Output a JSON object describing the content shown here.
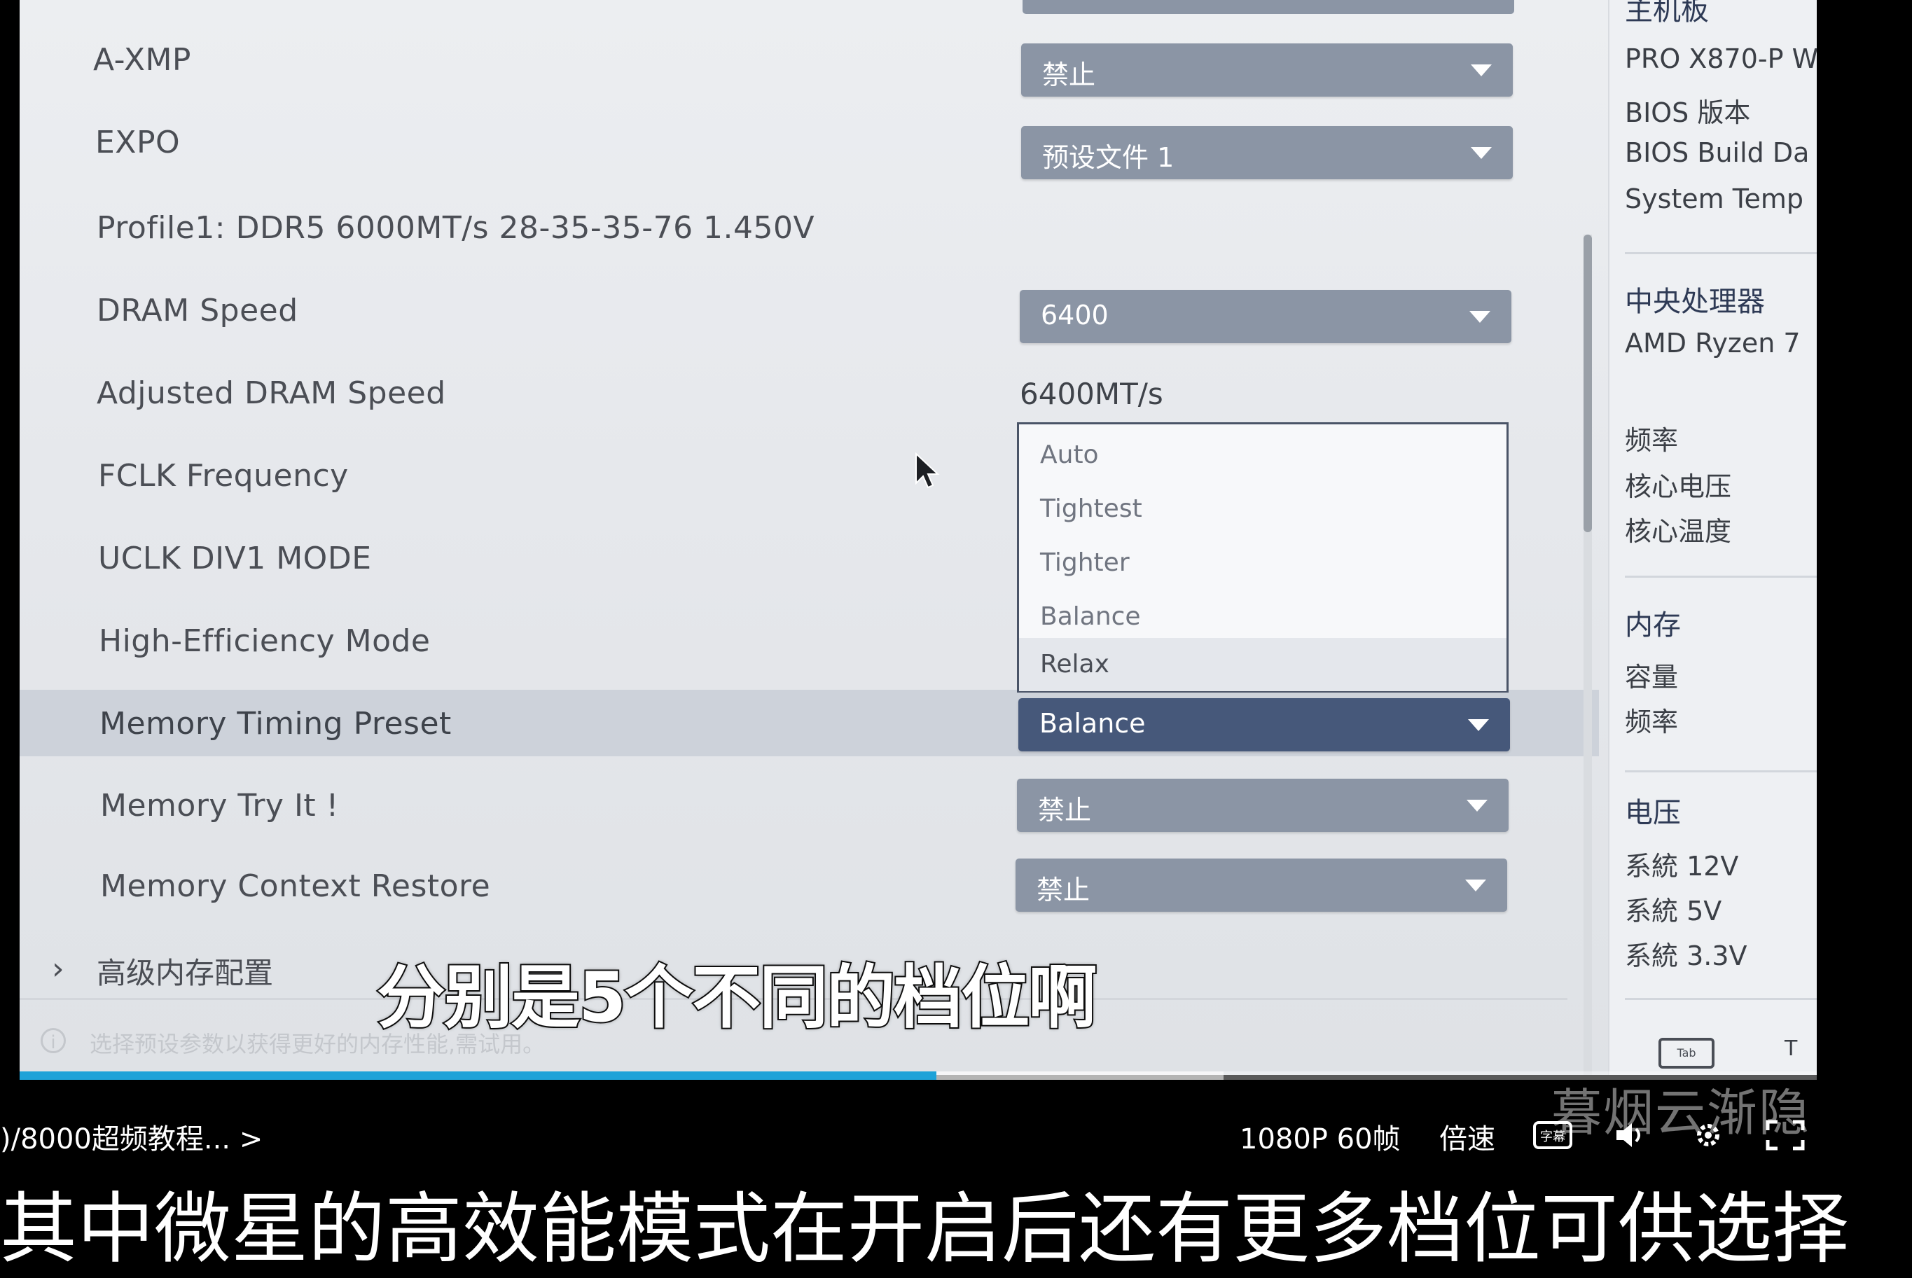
{
  "bios": {
    "settings": [
      {
        "label": "A-XMP",
        "value": "禁止"
      },
      {
        "label": "EXPO",
        "value": "预设文件 1"
      },
      {
        "label": "Profile1: DDR5 6000MT/s 28-35-35-76 1.450V"
      },
      {
        "label": "DRAM Speed",
        "value": "6400"
      },
      {
        "label": "Adjusted DRAM Speed",
        "value": "6400MT/s"
      },
      {
        "label": "FCLK Frequency"
      },
      {
        "label": "UCLK DIV1 MODE"
      },
      {
        "label": "High-Efficiency Mode"
      },
      {
        "label": "Memory Timing Preset",
        "value": "Balance"
      },
      {
        "label": "Memory Try It !",
        "value": "禁止"
      },
      {
        "label": "Memory Context Restore",
        "value": "禁止"
      }
    ],
    "dropdown_options": [
      "Auto",
      "Tightest",
      "Tighter",
      "Balance",
      "Relax"
    ],
    "hovered_option": "Relax",
    "expand_label": "高级内存配置",
    "hint": "选择预设参数以获得更好的内存性能,需试用。",
    "side_panel": {
      "items": [
        {
          "text": "主机板",
          "type": "section"
        },
        {
          "text": "PRO X870-P W",
          "type": "text"
        },
        {
          "text": "BIOS 版本",
          "type": "text"
        },
        {
          "text": "BIOS Build Da",
          "type": "text"
        },
        {
          "text": "System Temp",
          "type": "text"
        },
        {
          "text": "中央处理器",
          "type": "section"
        },
        {
          "text": "AMD Ryzen 7",
          "type": "text"
        },
        {
          "text": "频率",
          "type": "text"
        },
        {
          "text": "核心电压",
          "type": "text"
        },
        {
          "text": "核心温度",
          "type": "text"
        },
        {
          "text": "内存",
          "type": "section"
        },
        {
          "text": "容量",
          "type": "text"
        },
        {
          "text": "频率",
          "type": "text"
        },
        {
          "text": "电压",
          "type": "section"
        },
        {
          "text": "系統 12V",
          "type": "text"
        },
        {
          "text": "系統 5V",
          "type": "text"
        },
        {
          "text": "系統 3.3V",
          "type": "text"
        }
      ],
      "tab_key": "Tab",
      "tab_key_suffix": "T"
    }
  },
  "video": {
    "in_video_subtitle": "分别是5个不同的档位啊",
    "title": ")/8000超频教程... >",
    "quality": "1080P 60帧",
    "speed": "倍速",
    "subtitle_toggle": "字幕",
    "watermark": "暮烟云渐隐",
    "progress": 0.51,
    "buffered": 0.67
  },
  "caption": "其中微星的高效能模式在开启后还有更多档位可供选择",
  "colors": {
    "dropdown": "#8b95a5",
    "dropdown_selected": "#46587a",
    "progress": "#1ea2d8"
  }
}
